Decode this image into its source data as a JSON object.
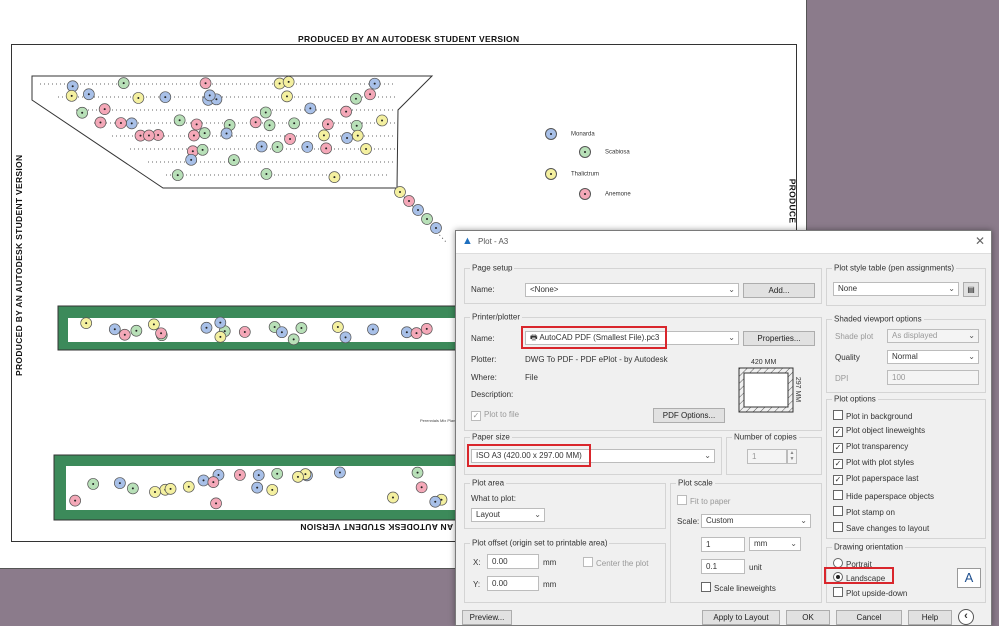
{
  "sheet": {
    "watermark_top": "PRODUCED BY AN AUTODESK STUDENT VERSION",
    "watermark_left": "PRODUCED BY AN AUTODESK STUDENT VERSION",
    "watermark_right": "PRODUCE",
    "watermark_bottom": "PRODUCED BY AN AUTODESK STUDENT VERSION",
    "legend": [
      {
        "label": "Monarda",
        "color": "#a8c0e8"
      },
      {
        "label": "Scabiosa",
        "color": "#b8e0b8"
      },
      {
        "label": "Thalictrum",
        "color": "#f4f0a0"
      },
      {
        "label": "Anemone",
        "color": "#f4a8b8"
      }
    ],
    "note": "Perennials Mix Plan Detail"
  },
  "dialog": {
    "title": "Plot - A3",
    "page_setup": {
      "group": "Page setup",
      "name_label": "Name:",
      "name_value": "<None>",
      "add_button": "Add..."
    },
    "printer": {
      "group": "Printer/plotter",
      "name_label": "Name:",
      "name_value": "AutoCAD PDF (Smallest File).pc3",
      "properties_button": "Properties...",
      "plotter_label": "Plotter:",
      "plotter_value": "DWG To PDF - PDF ePlot - by Autodesk",
      "where_label": "Where:",
      "where_value": "File",
      "description_label": "Description:",
      "plot_to_file": "Plot to file",
      "pdf_options_button": "PDF Options...",
      "preview_width": "420 MM",
      "preview_height": "297 MM"
    },
    "paper_size": {
      "group": "Paper size",
      "value": "ISO A3 (420.00 x 297.00 MM)"
    },
    "copies": {
      "group": "Number of copies",
      "value": "1"
    },
    "plot_area": {
      "group": "Plot area",
      "what_label": "What to plot:",
      "what_value": "Layout"
    },
    "plot_offset": {
      "group": "Plot offset (origin set to printable area)",
      "x_label": "X:",
      "x_value": "0.00",
      "x_unit": "mm",
      "y_label": "Y:",
      "y_value": "0.00",
      "y_unit": "mm",
      "center": "Center the plot"
    },
    "plot_scale": {
      "group": "Plot scale",
      "fit": "Fit to paper",
      "scale_label": "Scale:",
      "scale_value": "Custom",
      "v1": "1",
      "unit1": "mm",
      "v2": "0.1",
      "unit2": "unit",
      "lineweights": "Scale lineweights"
    },
    "style_table": {
      "group": "Plot style table (pen assignments)",
      "value": "None"
    },
    "shaded": {
      "group": "Shaded viewport options",
      "shade_label": "Shade plot",
      "shade_value": "As displayed",
      "quality_label": "Quality",
      "quality_value": "Normal",
      "dpi_label": "DPI",
      "dpi_value": "100"
    },
    "options": {
      "group": "Plot options",
      "items": [
        {
          "label": "Plot in background",
          "checked": ""
        },
        {
          "label": "Plot object lineweights",
          "checked": "✓"
        },
        {
          "label": "Plot transparency",
          "checked": "✓"
        },
        {
          "label": "Plot with plot styles",
          "checked": "✓"
        },
        {
          "label": "Plot paperspace last",
          "checked": "✓"
        },
        {
          "label": "Hide paperspace objects",
          "checked": ""
        },
        {
          "label": "Plot stamp on",
          "checked": ""
        },
        {
          "label": "Save changes to layout",
          "checked": ""
        }
      ]
    },
    "orientation": {
      "group": "Drawing orientation",
      "portrait": "Portrait",
      "landscape": "Landscape",
      "upside_down": "Plot upside-down",
      "icon_letter": "A"
    },
    "footer": {
      "preview": "Preview...",
      "apply": "Apply to Layout",
      "ok": "OK",
      "cancel": "Cancel",
      "help": "Help",
      "collapse": "‹"
    }
  }
}
